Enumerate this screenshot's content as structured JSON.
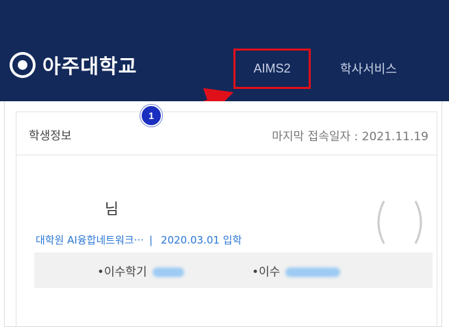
{
  "header": {
    "university_name": "아주대학교",
    "nav": [
      {
        "label": "AIMS2",
        "highlighted": true
      },
      {
        "label": "학사서비스",
        "highlighted": false
      }
    ],
    "background_color": "#13295a",
    "highlight_color": "#e0101a"
  },
  "annotation": {
    "step_number": "1",
    "arrow_color": "#e0101a"
  },
  "student_card": {
    "title": "학생정보",
    "last_login": "마지막 접속일자 : 2021.11.19",
    "name_suffix": "님",
    "department": "대학원 AI융합네트워크···",
    "separator": "|",
    "admission": "2020.03.01 입학",
    "info": [
      {
        "label": "•이수학기",
        "value_redacted": true
      },
      {
        "label": "•이수",
        "value_redacted": true
      }
    ],
    "link_color": "#2b77d6"
  }
}
